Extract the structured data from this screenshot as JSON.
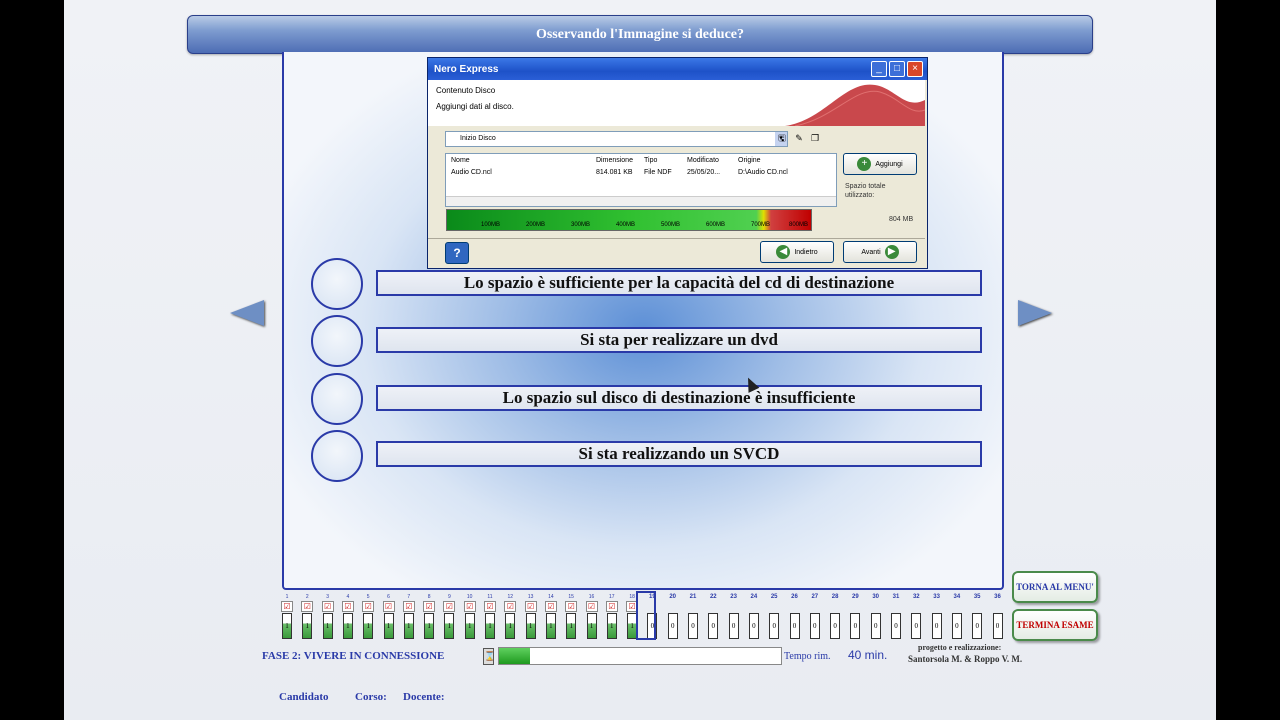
{
  "question": "Osservando l'Immagine si deduce?",
  "screenshot": {
    "window_title": "Nero Express",
    "header_title": "Contenuto Disco",
    "header_subtitle": "Aggiungi dati al disco.",
    "combo_value": "Inizio Disco",
    "list_headers": [
      "Nome",
      "Dimensione",
      "Tipo",
      "Modificato",
      "Origine"
    ],
    "list_row": [
      "Audio CD.ncl",
      "814.081 KB",
      "File NDF",
      "25/05/20...",
      "D:\\Audio CD.ncl"
    ],
    "add_button": "Aggiungi",
    "side_text": "Spazio totale utilizzato:",
    "used_size": "804 MB",
    "capacity_ticks": [
      "100MB",
      "200MB",
      "300MB",
      "400MB",
      "500MB",
      "600MB",
      "700MB",
      "800MB"
    ],
    "back_button": "Indietro",
    "next_button": "Avanti",
    "help_label": "?"
  },
  "answers": [
    "Lo spazio è sufficiente per la capacità del cd di destinazione",
    "Si sta per realizzare un dvd",
    "Lo spazio sul disco di destinazione è insufficiente",
    "Si sta realizzando un SVCD"
  ],
  "tracker": {
    "numbers": [
      "1",
      "2",
      "3",
      "4",
      "5",
      "6",
      "7",
      "8",
      "9",
      "10",
      "11",
      "12",
      "13",
      "14",
      "15",
      "16",
      "17",
      "18",
      "19",
      "20",
      "21",
      "22",
      "23",
      "24",
      "25",
      "26",
      "27",
      "28",
      "29",
      "30",
      "31",
      "32",
      "33",
      "34",
      "35",
      "36"
    ],
    "completed_count": 18,
    "current": "19",
    "check_mark": "☑",
    "done_value": "1",
    "pending_value": "0"
  },
  "buttons": {
    "menu": "TORNA AL MENU'",
    "end": "TERMINA ESAME"
  },
  "status": {
    "phase": "FASE 2: VIVERE IN CONNESSIONE",
    "progress_fraction": 0.11,
    "time_label": "Tempo rim.",
    "time_value": "40 min.",
    "credits_line1": "progetto e realizzazione:",
    "credits_line2": "Santorsola M. & Roppo V. M."
  },
  "labels": {
    "candidate": "Candidato",
    "course": "Corso:",
    "teacher": "Docente:"
  },
  "colors": {
    "accent_blue": "#2a3aa8",
    "success_green": "#1f9a1f",
    "danger_red": "#c00000"
  }
}
